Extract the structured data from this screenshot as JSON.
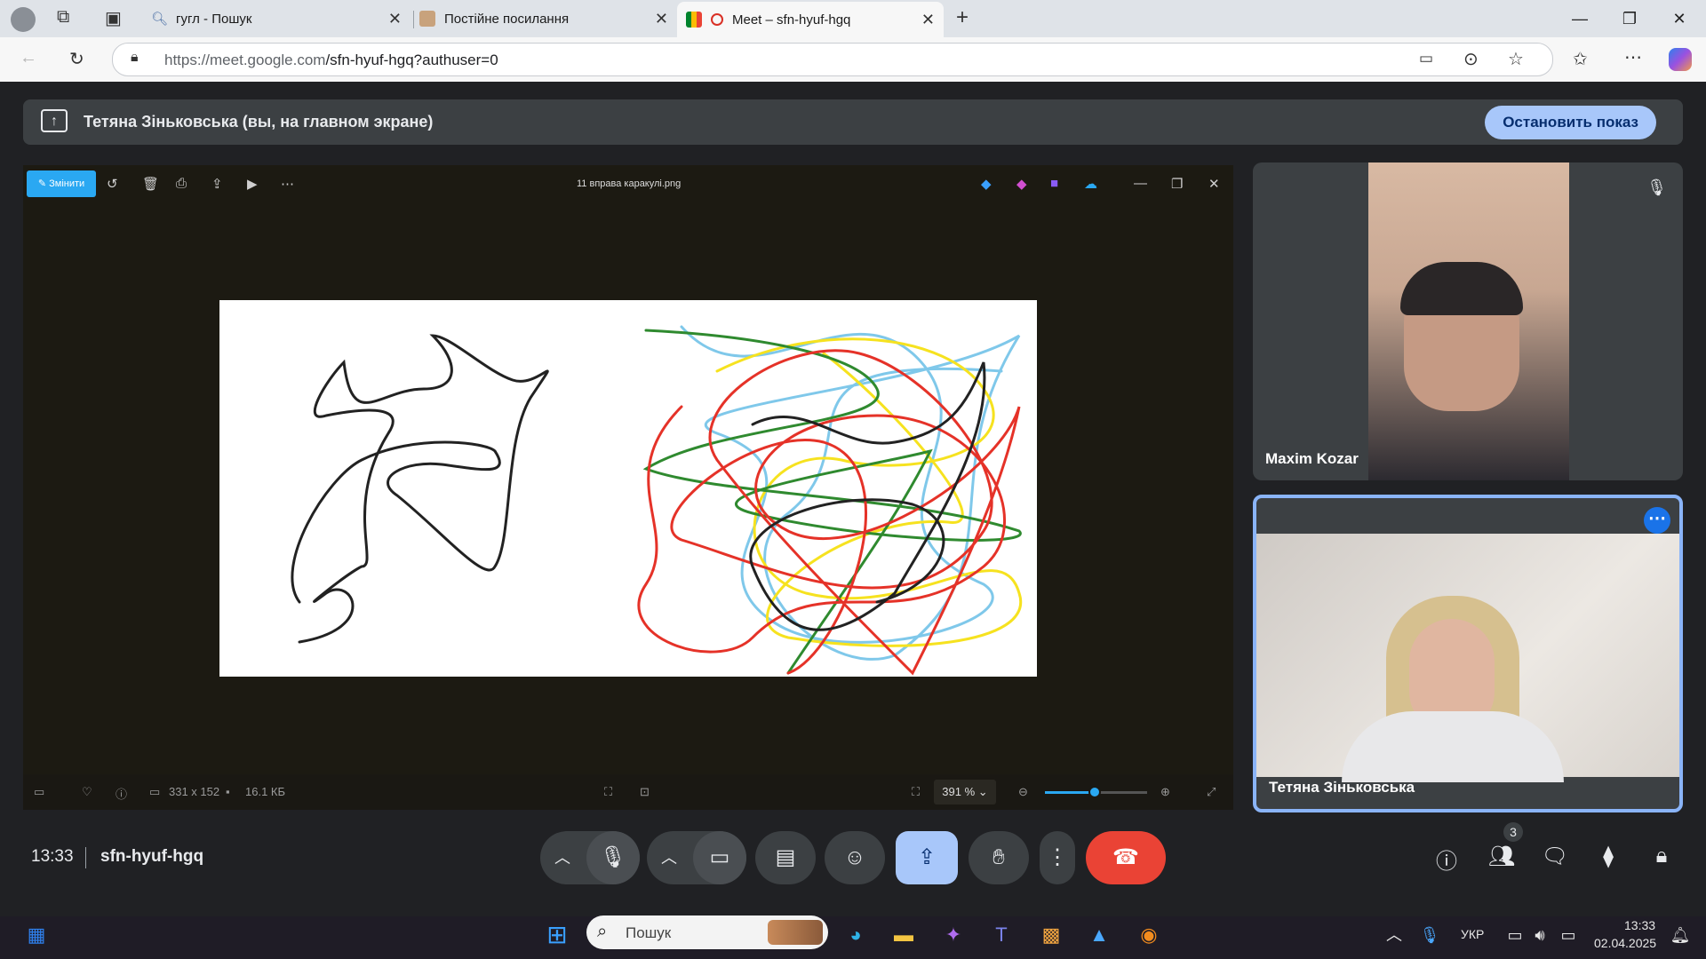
{
  "browser": {
    "tabs": [
      {
        "title": "гугл - Пошук"
      },
      {
        "title": "Постійне посилання"
      },
      {
        "title": "Meet – sfn-hyuf-hgq",
        "active": true
      }
    ],
    "url_host": "https://meet.google.com",
    "url_path": "/sfn-hyuf-hgq?authuser=0"
  },
  "meet": {
    "banner_text": "Тетяна Зіньковська (вы, на главном экране)",
    "stop_button": "Остановить показ",
    "time": "13:33",
    "meeting_code": "sfn-hyuf-hgq",
    "people_count": "3",
    "participants": [
      {
        "name": "Maxim Kozar"
      },
      {
        "name": "Тетяна Зіньковська"
      }
    ]
  },
  "photos": {
    "edit_label": "Змінити",
    "filename": "11 вправа каракулі.png",
    "dimensions": "331 x 152",
    "filesize": "16.1 КБ",
    "zoom": "391 %",
    "zoom_slider_fraction": 0.49
  },
  "taskbar": {
    "search_placeholder": "Пошук",
    "lang": "УКР",
    "time": "13:33",
    "date": "02.04.2025"
  },
  "colors": {
    "accent": "#a8c7fa",
    "end_call": "#ea4335",
    "present_active": "#a8c7fa",
    "photos_accent": "#2aa8f2"
  }
}
